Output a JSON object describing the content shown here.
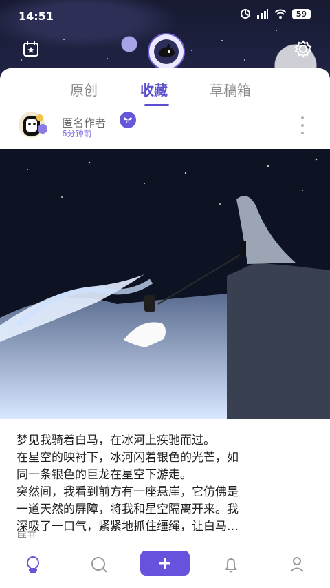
{
  "status_bar": {
    "time": "14:51",
    "battery": "59"
  },
  "tabs": [
    {
      "label": "原创",
      "active": false
    },
    {
      "label": "收藏",
      "active": true
    },
    {
      "label": "草稿箱",
      "active": false
    }
  ],
  "post": {
    "author_name": "匿名作者",
    "time": "6分钟前",
    "text_lines": [
      "梦见我骑着白马，在冰河上疾驰而过。",
      "在星空的映衬下，冰河闪着银色的光芒，如",
      "同一条银色的巨龙在星空下游走。",
      "突然间，我看到前方有一座悬崖，它仿佛是",
      "一道天然的屏障，将我和星空隔离开来。我",
      "深吸了一口气，紧紧地抓住缰绳，让白马…"
    ],
    "expand_label": "展开"
  },
  "nav": {
    "icons": [
      "home-icon",
      "search-icon",
      "add-icon",
      "bell-icon",
      "profile-icon"
    ]
  },
  "colors": {
    "accent": "#5b4fcf",
    "dark_bg": "#1b1d33"
  }
}
